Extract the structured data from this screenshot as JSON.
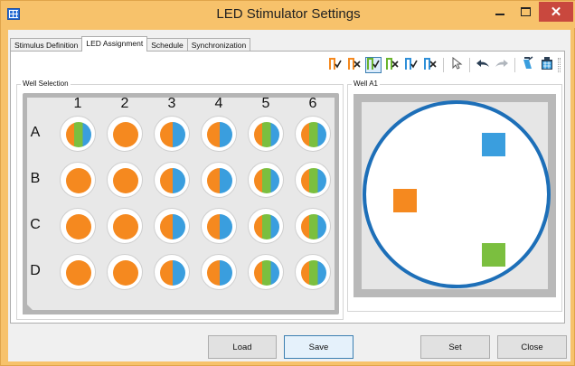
{
  "window": {
    "title": "LED Stimulator Settings",
    "icon": "grid-app-icon",
    "controls": [
      "minimize",
      "maximize",
      "close"
    ]
  },
  "tabs": [
    {
      "label": "Stimulus Definition",
      "active": false
    },
    {
      "label": "LED Assignment",
      "active": true
    },
    {
      "label": "Schedule",
      "active": false
    },
    {
      "label": "Synchronization",
      "active": false
    }
  ],
  "toolbar": {
    "buttons": [
      {
        "icon": "pulse-orange-check-icon",
        "color": "#f5891f",
        "mark": "check"
      },
      {
        "icon": "pulse-orange-cross-icon",
        "color": "#f5891f",
        "mark": "cross"
      },
      {
        "icon": "pulse-green-check-icon",
        "color": "#6ab42d",
        "mark": "check",
        "active": true
      },
      {
        "icon": "pulse-green-cross-icon",
        "color": "#6ab42d",
        "mark": "cross"
      },
      {
        "icon": "pulse-blue-check-icon",
        "color": "#2f8fd8",
        "mark": "check"
      },
      {
        "icon": "pulse-blue-cross-icon",
        "color": "#2f8fd8",
        "mark": "cross"
      }
    ],
    "tools": [
      "pointer-icon",
      "undo-icon",
      "redo-icon",
      "fill-icon",
      "plate-icon"
    ]
  },
  "well_selection": {
    "title": "Well Selection",
    "columns": [
      "1",
      "2",
      "3",
      "4",
      "5",
      "6"
    ],
    "rows": [
      {
        "label": "A",
        "wells": [
          "ogb",
          "o",
          "ob",
          "ob",
          "ogb",
          "ogb"
        ]
      },
      {
        "label": "B",
        "wells": [
          "o",
          "o",
          "ob",
          "ob",
          "ogb",
          "ogb"
        ]
      },
      {
        "label": "C",
        "wells": [
          "o",
          "o",
          "ob",
          "ob",
          "ogb",
          "ogb"
        ]
      },
      {
        "label": "D",
        "wells": [
          "o",
          "o",
          "ob",
          "ob",
          "ogb",
          "ogb"
        ]
      }
    ]
  },
  "well_preview": {
    "title": "Well A1",
    "leds": [
      {
        "name": "blue-led",
        "color": "#3a9ede"
      },
      {
        "name": "orange-led",
        "color": "#f5891f"
      },
      {
        "name": "green-led",
        "color": "#7bbf3f"
      }
    ]
  },
  "buttons": {
    "load": "Load",
    "save": "Save",
    "set": "Set",
    "close": "Close"
  },
  "colors": {
    "orange": "#f5891f",
    "green": "#7bbf3f",
    "blue": "#3a9ede",
    "title_bar": "#f7c26b",
    "ring": "#1d6fb8"
  }
}
